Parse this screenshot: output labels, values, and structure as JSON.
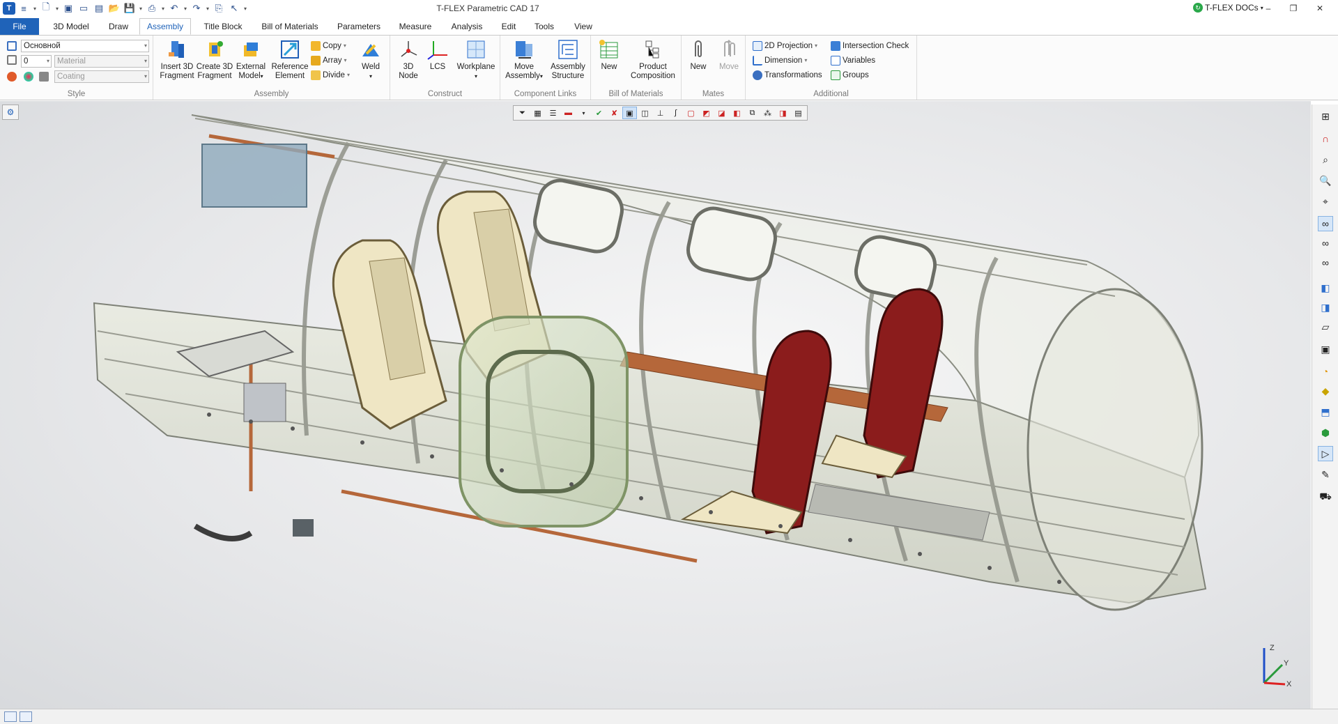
{
  "titlebar": {
    "app_title": "T-FLEX Parametric CAD 17",
    "docs_label": "T-FLEX DOCs",
    "win_min": "–",
    "win_restore": "❐",
    "win_close": "✕"
  },
  "tabs": [
    {
      "label": "File"
    },
    {
      "label": "3D Model"
    },
    {
      "label": "Draw"
    },
    {
      "label": "Assembly"
    },
    {
      "label": "Title Block"
    },
    {
      "label": "Bill of Materials"
    },
    {
      "label": "Parameters"
    },
    {
      "label": "Measure"
    },
    {
      "label": "Analysis"
    },
    {
      "label": "Edit"
    },
    {
      "label": "Tools"
    },
    {
      "label": "View"
    }
  ],
  "ribbon": {
    "style": {
      "title": "Style",
      "layer_value": "Основной",
      "level_value": "0",
      "material_placeholder": "Material",
      "coating_placeholder": "Coating"
    },
    "assembly": {
      "title": "Assembly",
      "insert_3d_fragment": [
        "Insert 3D",
        "Fragment"
      ],
      "create_3d_fragment": [
        "Create 3D",
        "Fragment"
      ],
      "external_model": [
        "External",
        "Model"
      ],
      "reference_element": [
        "Reference",
        "Element"
      ],
      "copy": "Copy",
      "array": "Array",
      "divide": "Divide",
      "weld": "Weld"
    },
    "construct": {
      "title": "Construct",
      "node_3d": [
        "3D",
        "Node"
      ],
      "lcs": "LCS",
      "workplane": "Workplane"
    },
    "component_links": {
      "title": "Component Links",
      "move_assembly": [
        "Move",
        "Assembly"
      ],
      "assembly_structure": [
        "Assembly",
        "Structure"
      ]
    },
    "bom": {
      "title": "Bill of Materials",
      "new": "New",
      "product_composition": [
        "Product",
        "Composition"
      ]
    },
    "mates": {
      "title": "Mates",
      "new": "New",
      "move": "Move"
    },
    "additional": {
      "title": "Additional",
      "projection_2d": "2D Projection",
      "dimension": "Dimension",
      "transformations": "Transformations",
      "intersection_check": "Intersection Check",
      "variables": "Variables",
      "groups": "Groups"
    }
  },
  "triad": {
    "z": "Z",
    "y": "Y",
    "x": "X"
  },
  "colors": {
    "accent": "#1f63b9",
    "seat_red": "#8b1c1c",
    "seat_cream": "#efe6c4",
    "copper": "#b5673a",
    "frame": "#9e9e9e"
  }
}
